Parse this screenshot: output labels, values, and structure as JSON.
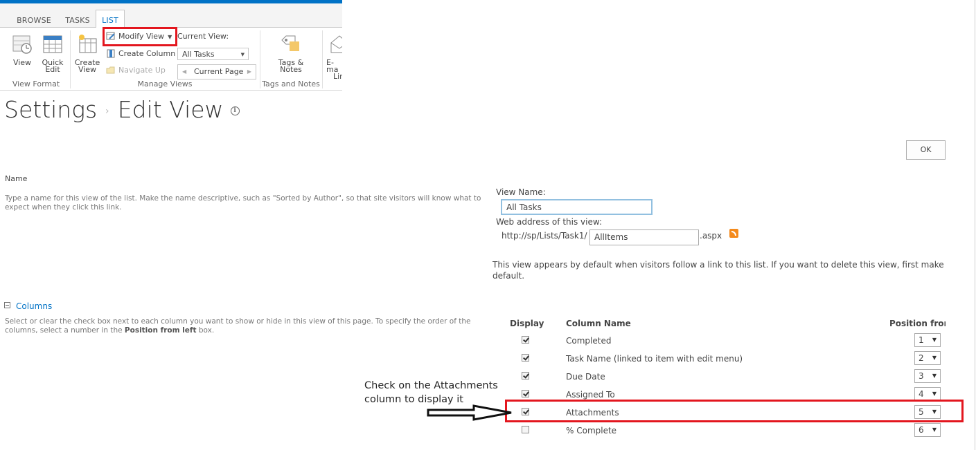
{
  "ribbon": {
    "tabs": [
      {
        "label": "BROWSE",
        "active": false
      },
      {
        "label": "TASKS",
        "active": false
      },
      {
        "label": "LIST",
        "active": true
      }
    ],
    "view_format": {
      "group_label": "View Format",
      "view_label": "View",
      "quick_edit_label_1": "Quick",
      "quick_edit_label_2": "Edit"
    },
    "manage_views": {
      "group_label": "Manage Views",
      "create_view_label_1": "Create",
      "create_view_label_2": "View",
      "modify_view_label": "Modify View",
      "create_column_label": "Create Column",
      "navigate_up_label": "Navigate Up",
      "current_view_label": "Current View:",
      "current_view_value": "All Tasks",
      "current_page_label": "Current Page"
    },
    "tags_notes": {
      "group_label": "Tags and Notes",
      "label_1": "Tags &",
      "label_2": "Notes"
    },
    "email_link": {
      "label_1": "E-ma",
      "label_2": "Lin"
    }
  },
  "page": {
    "title_1": "Settings",
    "title_sep": "›",
    "title_2": "Edit View",
    "info_icon": "i",
    "ok_label": "OK"
  },
  "name_section": {
    "title": "Name",
    "description_line_1": "Type a name for this view of the list. Make the name descriptive, such as \"Sorted by Author\", so that site visitors will know what to",
    "description_line_2": "expect when they click this link.",
    "view_name_label": "View Name:",
    "view_name_value": "All Tasks",
    "web_address_label": "Web address of this view:",
    "url_prefix": "http://sp/Lists/Task1/",
    "url_value": "AllItems",
    "url_suffix": ".aspx",
    "default_note_line_1": "This view appears by default when visitors follow a link to this list. If you want to delete this view, first make anoth",
    "default_note_line_2": "default."
  },
  "columns_section": {
    "title": "Columns",
    "description_line_1": "Select or clear the check box next to each column you want to show or hide in this view of this page. To specify the order of the",
    "description_line_2_a": "columns, select a number in the ",
    "description_line_2_b": "Position from left",
    "description_line_2_c": " box.",
    "header_display": "Display",
    "header_column_name": "Column Name",
    "header_position": "Position from",
    "rows": [
      {
        "name": "Completed",
        "checked": true,
        "position": "1"
      },
      {
        "name": "Task Name (linked to item with edit menu)",
        "checked": true,
        "position": "2"
      },
      {
        "name": "Due Date",
        "checked": true,
        "position": "3"
      },
      {
        "name": "Assigned To",
        "checked": true,
        "position": "4"
      },
      {
        "name": "Attachments",
        "checked": true,
        "position": "5"
      },
      {
        "name": "% Complete",
        "checked": false,
        "position": "6"
      }
    ]
  },
  "annotation": {
    "line_1": "Check on the Attachments",
    "line_2": "column to display it"
  },
  "colors": {
    "accent_blue": "#0072c6",
    "highlight_red": "#e3161e",
    "rss_orange": "#f48a1c"
  }
}
